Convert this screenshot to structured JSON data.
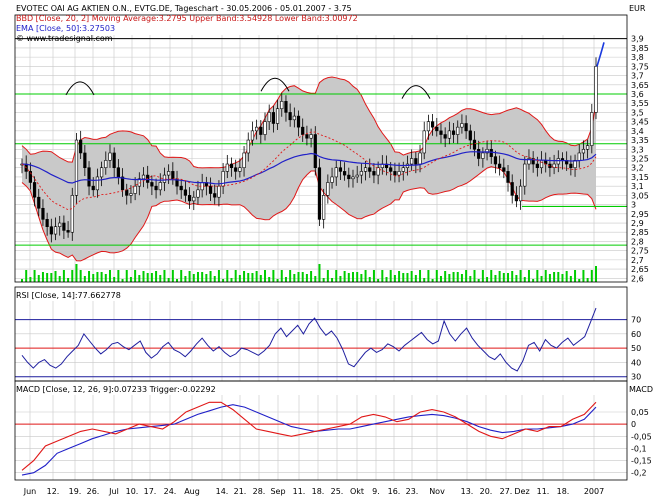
{
  "header": {
    "title": "EVOTEC OAI AG AKTIEN O.N., EVTG.DE, Tageschart - 30.05.2006 - 05.01.2007 - 3.75",
    "currency": "EUR",
    "bb_label": "BBD [Close, 20, 2] Moving Average:3.2795 Upper Band:3.54928 Lower Band:3.00972",
    "ema_label": "EMA [Close, 50]:3.27503",
    "source": "© www.tradesignal.com"
  },
  "colors": {
    "grid": "#c8c8c8",
    "band_fill": "#c9c9c9",
    "band_edge": "#e01818",
    "ma": "#e01818",
    "ema": "#2020c8",
    "support": "#00cc00",
    "volume": "#00cc00",
    "candle": "#000000",
    "rsi_line": "#2020a0",
    "rsi_ref_low": "#e01818",
    "rsi_ref_high": "#2020a0",
    "macd": "#2020c8",
    "trigger": "#e01818",
    "trend_arrow": "#1a3adf"
  },
  "chart_data": [
    {
      "type": "candlestick",
      "title": "EVOTEC OAI AG AKTIEN O.N., EVTG.DE, Tageschart - 30.05.2006 - 05.01.2007 - 3.75",
      "ylabel": "EUR",
      "ylim": [
        2.58,
        3.92
      ],
      "y_ticks": [
        3.9,
        3.85,
        3.8,
        3.75,
        3.7,
        3.65,
        3.6,
        3.55,
        3.5,
        3.45,
        3.4,
        3.35,
        3.3,
        3.25,
        3.2,
        3.15,
        3.1,
        3.05,
        3.0,
        2.95,
        2.9,
        2.85,
        2.8,
        2.75,
        2.7,
        2.65,
        2.6
      ],
      "x_ticks": [
        "Jun",
        "12.",
        "19.",
        "26.",
        "Jul",
        "10.",
        "17.",
        "24.",
        "Aug",
        "14.",
        "21.",
        "28.",
        "Sep",
        "11.",
        "18.",
        "25.",
        "Okt",
        "9.",
        "16.",
        "23.",
        "Nov",
        "13.",
        "20.",
        "27.",
        "Dez",
        "11.",
        "18.",
        "2007"
      ],
      "grid": true,
      "horizontal_lines": [
        3.6,
        3.33,
        2.78,
        3.9
      ],
      "support_segment": {
        "from": "Dez",
        "to": "2007",
        "value": 2.99
      },
      "last_close": 3.75,
      "series": [
        {
          "name": "Close",
          "points": [
            3.22,
            3.18,
            3.12,
            3.04,
            2.98,
            2.92,
            2.88,
            2.84,
            2.88,
            2.9,
            2.86,
            2.85,
            3.05,
            3.35,
            3.28,
            3.2,
            3.1,
            3.08,
            3.15,
            3.2,
            3.24,
            3.28,
            3.2,
            3.15,
            3.08,
            3.05,
            3.06,
            3.1,
            3.14,
            3.16,
            3.12,
            3.1,
            3.08,
            3.12,
            3.16,
            3.18,
            3.14,
            3.1,
            3.08,
            3.05,
            3.02,
            3.04,
            3.08,
            3.12,
            3.1,
            3.06,
            3.04,
            3.1,
            3.18,
            3.22,
            3.2,
            3.18,
            3.2,
            3.28,
            3.35,
            3.4,
            3.42,
            3.38,
            3.45,
            3.5,
            3.44,
            3.52,
            3.56,
            3.5,
            3.46,
            3.48,
            3.42,
            3.38,
            3.36,
            3.38,
            3.2,
            2.92,
            3.05,
            3.12,
            3.15,
            3.2,
            3.18,
            3.16,
            3.14,
            3.15,
            3.16,
            3.18,
            3.2,
            3.18,
            3.16,
            3.2,
            3.22,
            3.2,
            3.18,
            3.16,
            3.18,
            3.2,
            3.22,
            3.25,
            3.22,
            3.28,
            3.4,
            3.45,
            3.42,
            3.4,
            3.38,
            3.36,
            3.4,
            3.38,
            3.42,
            3.44,
            3.4,
            3.35,
            3.3,
            3.25,
            3.28,
            3.3,
            3.26,
            3.22,
            3.2,
            3.18,
            3.12,
            3.05,
            3.02,
            3.1,
            3.22,
            3.25,
            3.22,
            3.2,
            3.24,
            3.22,
            3.2,
            3.22,
            3.25,
            3.24,
            3.22,
            3.2,
            3.24,
            3.28,
            3.3,
            3.32,
            3.5,
            3.75
          ]
        },
        {
          "name": "BBD Upper Band",
          "value": 3.54928
        },
        {
          "name": "BBD Moving Average",
          "value": 3.2795
        },
        {
          "name": "BBD Lower Band",
          "value": 3.00972
        },
        {
          "name": "EMA [Close, 50]",
          "value": 3.27503
        }
      ]
    },
    {
      "type": "line",
      "title": "RSI [Close, 14]:77.662778",
      "ylim": [
        27,
        83
      ],
      "y_ticks": [
        70,
        60,
        50,
        40,
        30
      ],
      "reference_lines": [
        {
          "value": 70,
          "color": "ref_high"
        },
        {
          "value": 50,
          "color": "ref_low"
        },
        {
          "value": 30,
          "color": "ref_high"
        }
      ],
      "series": [
        {
          "name": "RSI",
          "last": 77.662778,
          "values": [
            45,
            40,
            36,
            40,
            42,
            38,
            36,
            39,
            44,
            48,
            52,
            60,
            55,
            50,
            46,
            49,
            53,
            54,
            51,
            49,
            52,
            55,
            47,
            43,
            46,
            51,
            54,
            49,
            47,
            44,
            48,
            53,
            57,
            52,
            48,
            51,
            47,
            44,
            46,
            50,
            49,
            47,
            45,
            48,
            52,
            60,
            64,
            58,
            62,
            66,
            60,
            67,
            71,
            64,
            59,
            62,
            57,
            49,
            39,
            37,
            42,
            47,
            50,
            47,
            49,
            53,
            51,
            48,
            52,
            55,
            58,
            61,
            56,
            53,
            55,
            69,
            60,
            55,
            60,
            64,
            57,
            52,
            48,
            44,
            42,
            46,
            40,
            36,
            34,
            41,
            52,
            54,
            48,
            56,
            52,
            50,
            54,
            57,
            52,
            55,
            58,
            68,
            78
          ]
        }
      ]
    },
    {
      "type": "line",
      "title": "MACD [Close, 12, 26, 9]:0.07233 Trigger:-0.02292",
      "ylabel": "MACD",
      "ylim": [
        -0.23,
        0.12
      ],
      "y_ticks": [
        0.05,
        0,
        -0.05,
        -0.1,
        -0.15,
        -0.2
      ],
      "reference_lines": [
        {
          "value": 0,
          "color": "ref_low"
        }
      ],
      "series": [
        {
          "name": "MACD",
          "last": 0.07233,
          "values": [
            -0.21,
            -0.2,
            -0.17,
            -0.12,
            -0.1,
            -0.08,
            -0.06,
            -0.045,
            -0.03,
            -0.02,
            -0.015,
            -0.01,
            -0.005,
            0.0,
            0.02,
            0.04,
            0.055,
            0.07,
            0.08,
            0.07,
            0.05,
            0.03,
            0.01,
            -0.01,
            -0.02,
            -0.03,
            -0.025,
            -0.02,
            -0.02,
            -0.01,
            0.0,
            0.01,
            0.02,
            0.03,
            0.035,
            0.04,
            0.035,
            0.025,
            0.01,
            -0.01,
            -0.025,
            -0.035,
            -0.03,
            -0.02,
            -0.02,
            -0.015,
            -0.01,
            0.0,
            0.02,
            0.07
          ]
        },
        {
          "name": "Trigger",
          "last": -0.02292,
          "values": [
            -0.19,
            -0.15,
            -0.09,
            -0.07,
            -0.05,
            -0.03,
            -0.02,
            -0.03,
            -0.04,
            -0.02,
            0.0,
            -0.01,
            -0.02,
            0.01,
            0.05,
            0.07,
            0.09,
            0.09,
            0.06,
            0.02,
            -0.02,
            -0.03,
            -0.04,
            -0.05,
            -0.04,
            -0.03,
            -0.02,
            -0.01,
            0.0,
            0.03,
            0.04,
            0.03,
            0.01,
            0.02,
            0.05,
            0.06,
            0.05,
            0.03,
            0.0,
            -0.03,
            -0.05,
            -0.06,
            -0.04,
            -0.02,
            -0.03,
            -0.01,
            -0.01,
            0.02,
            0.04,
            0.09
          ]
        }
      ]
    }
  ]
}
